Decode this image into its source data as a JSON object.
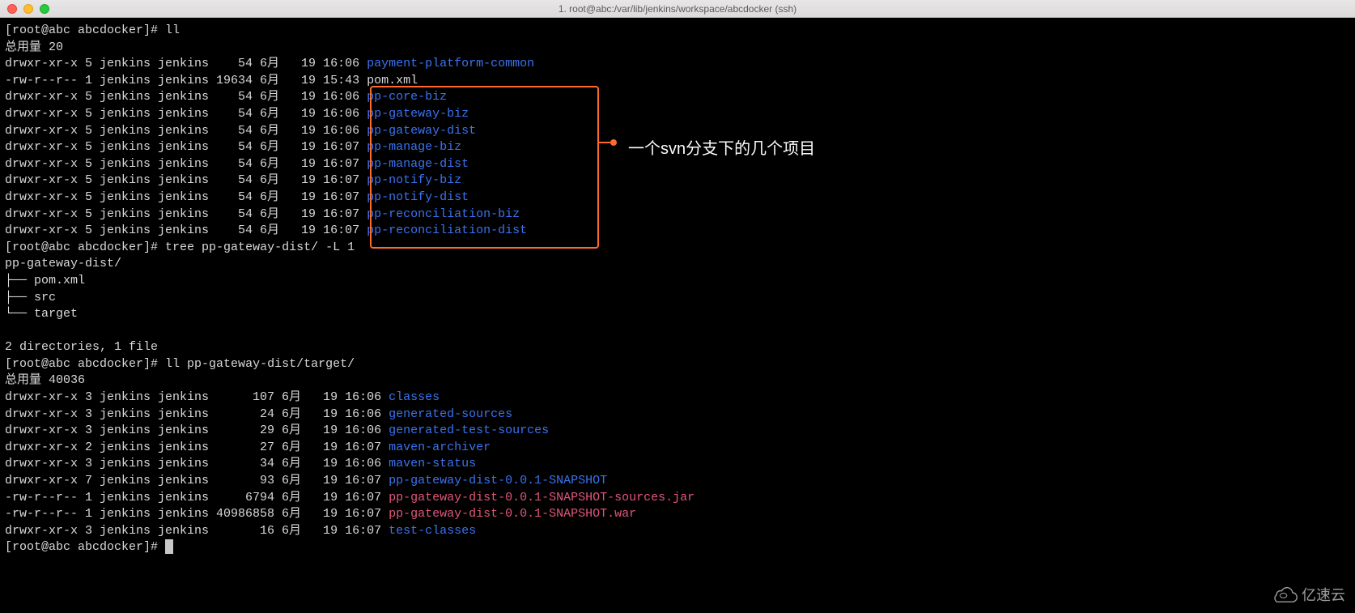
{
  "titlebar": {
    "title": "1. root@abc:/var/lib/jenkins/workspace/abcdocker (ssh)"
  },
  "terminal": {
    "prompt1": "[root@abc abcdocker]# ",
    "cmd1": "ll",
    "total1": "总用量 20",
    "ll1": [
      {
        "perm": "drwxr-xr-x",
        "n": "5",
        "own": "jenkins",
        "grp": "jenkins",
        "size": "   54",
        "mon": "6月",
        "dd": "  19",
        "tm": "16:06",
        "name": "payment-platform-common",
        "cls": "blue"
      },
      {
        "perm": "-rw-r--r--",
        "n": "1",
        "own": "jenkins",
        "grp": "jenkins",
        "size": "19634",
        "mon": "6月",
        "dd": "  19",
        "tm": "15:43",
        "name": "pom.xml",
        "cls": ""
      },
      {
        "perm": "drwxr-xr-x",
        "n": "5",
        "own": "jenkins",
        "grp": "jenkins",
        "size": "   54",
        "mon": "6月",
        "dd": "  19",
        "tm": "16:06",
        "name": "pp-core-biz",
        "cls": "blue"
      },
      {
        "perm": "drwxr-xr-x",
        "n": "5",
        "own": "jenkins",
        "grp": "jenkins",
        "size": "   54",
        "mon": "6月",
        "dd": "  19",
        "tm": "16:06",
        "name": "pp-gateway-biz",
        "cls": "blue"
      },
      {
        "perm": "drwxr-xr-x",
        "n": "5",
        "own": "jenkins",
        "grp": "jenkins",
        "size": "   54",
        "mon": "6月",
        "dd": "  19",
        "tm": "16:06",
        "name": "pp-gateway-dist",
        "cls": "blue"
      },
      {
        "perm": "drwxr-xr-x",
        "n": "5",
        "own": "jenkins",
        "grp": "jenkins",
        "size": "   54",
        "mon": "6月",
        "dd": "  19",
        "tm": "16:07",
        "name": "pp-manage-biz",
        "cls": "blue"
      },
      {
        "perm": "drwxr-xr-x",
        "n": "5",
        "own": "jenkins",
        "grp": "jenkins",
        "size": "   54",
        "mon": "6月",
        "dd": "  19",
        "tm": "16:07",
        "name": "pp-manage-dist",
        "cls": "blue"
      },
      {
        "perm": "drwxr-xr-x",
        "n": "5",
        "own": "jenkins",
        "grp": "jenkins",
        "size": "   54",
        "mon": "6月",
        "dd": "  19",
        "tm": "16:07",
        "name": "pp-notify-biz",
        "cls": "blue"
      },
      {
        "perm": "drwxr-xr-x",
        "n": "5",
        "own": "jenkins",
        "grp": "jenkins",
        "size": "   54",
        "mon": "6月",
        "dd": "  19",
        "tm": "16:07",
        "name": "pp-notify-dist",
        "cls": "blue"
      },
      {
        "perm": "drwxr-xr-x",
        "n": "5",
        "own": "jenkins",
        "grp": "jenkins",
        "size": "   54",
        "mon": "6月",
        "dd": "  19",
        "tm": "16:07",
        "name": "pp-reconciliation-biz",
        "cls": "blue"
      },
      {
        "perm": "drwxr-xr-x",
        "n": "5",
        "own": "jenkins",
        "grp": "jenkins",
        "size": "   54",
        "mon": "6月",
        "dd": "  19",
        "tm": "16:07",
        "name": "pp-reconciliation-dist",
        "cls": "blue"
      }
    ],
    "prompt2": "[root@abc abcdocker]# ",
    "cmd2": "tree pp-gateway-dist/ -L 1",
    "tree_root": "pp-gateway-dist/",
    "tree_children": [
      "pom.xml",
      "src",
      "target"
    ],
    "tree_summary": "2 directories, 1 file",
    "prompt3": "[root@abc abcdocker]# ",
    "cmd3": "ll pp-gateway-dist/target/",
    "total2": "总用量 40036",
    "ll2": [
      {
        "perm": "drwxr-xr-x",
        "n": "3",
        "own": "jenkins",
        "grp": "jenkins",
        "size": "     107",
        "mon": "6月",
        "dd": "  19",
        "tm": "16:06",
        "name": "classes",
        "cls": "blue"
      },
      {
        "perm": "drwxr-xr-x",
        "n": "3",
        "own": "jenkins",
        "grp": "jenkins",
        "size": "      24",
        "mon": "6月",
        "dd": "  19",
        "tm": "16:06",
        "name": "generated-sources",
        "cls": "blue"
      },
      {
        "perm": "drwxr-xr-x",
        "n": "3",
        "own": "jenkins",
        "grp": "jenkins",
        "size": "      29",
        "mon": "6月",
        "dd": "  19",
        "tm": "16:06",
        "name": "generated-test-sources",
        "cls": "blue"
      },
      {
        "perm": "drwxr-xr-x",
        "n": "2",
        "own": "jenkins",
        "grp": "jenkins",
        "size": "      27",
        "mon": "6月",
        "dd": "  19",
        "tm": "16:07",
        "name": "maven-archiver",
        "cls": "blue"
      },
      {
        "perm": "drwxr-xr-x",
        "n": "3",
        "own": "jenkins",
        "grp": "jenkins",
        "size": "      34",
        "mon": "6月",
        "dd": "  19",
        "tm": "16:06",
        "name": "maven-status",
        "cls": "blue"
      },
      {
        "perm": "drwxr-xr-x",
        "n": "7",
        "own": "jenkins",
        "grp": "jenkins",
        "size": "      93",
        "mon": "6月",
        "dd": "  19",
        "tm": "16:07",
        "name": "pp-gateway-dist-0.0.1-SNAPSHOT",
        "cls": "blue"
      },
      {
        "perm": "-rw-r--r--",
        "n": "1",
        "own": "jenkins",
        "grp": "jenkins",
        "size": "    6794",
        "mon": "6月",
        "dd": "  19",
        "tm": "16:07",
        "name": "pp-gateway-dist-0.0.1-SNAPSHOT-sources.jar",
        "cls": "magenta"
      },
      {
        "perm": "-rw-r--r--",
        "n": "1",
        "own": "jenkins",
        "grp": "jenkins",
        "size": "40986858",
        "mon": "6月",
        "dd": "  19",
        "tm": "16:07",
        "name": "pp-gateway-dist-0.0.1-SNAPSHOT.war",
        "cls": "magenta"
      },
      {
        "perm": "drwxr-xr-x",
        "n": "3",
        "own": "jenkins",
        "grp": "jenkins",
        "size": "      16",
        "mon": "6月",
        "dd": "  19",
        "tm": "16:07",
        "name": "test-classes",
        "cls": "blue"
      }
    ],
    "prompt4": "[root@abc abcdocker]# "
  },
  "annotation": "一个svn分支下的几个项目",
  "watermark": "亿速云"
}
